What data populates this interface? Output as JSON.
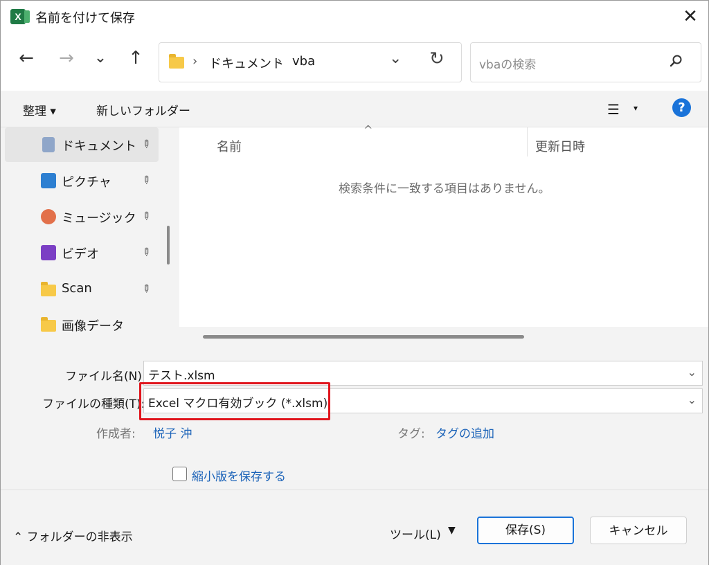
{
  "titlebar": {
    "title": "名前を付けて保存",
    "app_icon": "excel-icon",
    "app_icon_letter": "X",
    "close_glyph": "✕"
  },
  "nav": {
    "back_glyph": "←",
    "forward_glyph": "→",
    "recent_glyph": "⌄",
    "up_glyph": "↑",
    "breadcrumb": [
      "ドキュメント",
      "vba"
    ],
    "crumb_sep": "›",
    "address_dropdown_glyph": "⌄",
    "refresh_glyph": "↻",
    "search_placeholder": "vbaの検索"
  },
  "command_bar": {
    "organize_label": "整理 ▾",
    "new_folder_label": "新しいフォルダー",
    "view_glyph": "☰",
    "view_caret": "▾",
    "help_glyph": "?"
  },
  "sidebar": {
    "items": [
      {
        "label": "ドキュメント",
        "icon": "document-icon",
        "pinned": true,
        "active": true
      },
      {
        "label": "ピクチャ",
        "icon": "pictures-icon",
        "pinned": true
      },
      {
        "label": "ミュージック",
        "icon": "music-icon",
        "pinned": true
      },
      {
        "label": "ビデオ",
        "icon": "video-icon",
        "pinned": true
      },
      {
        "label": "Scan",
        "icon": "folder-icon",
        "pinned": true
      },
      {
        "label": "画像データ",
        "icon": "folder-icon",
        "pinned": false
      }
    ],
    "pin_glyph": "📌"
  },
  "file_list": {
    "columns": [
      "名前",
      "更新日時"
    ],
    "sort_glyph": "^",
    "empty_message": "検索条件に一致する項目はありません。"
  },
  "form": {
    "filename_label": "ファイル名(N):",
    "filename_value": "テスト.xlsm",
    "filetype_label": "ファイルの種類(T):",
    "filetype_value": "Excel マクロ有効ブック (*.xlsm)",
    "author_label": "作成者:",
    "author_value": "悦子 沖",
    "tag_label": "タグ:",
    "tag_value": "タグの追加",
    "thumbnail_label": "縮小版を保存する",
    "dropdown_glyph": "⌄",
    "highlight_color": "#e0151d"
  },
  "footer": {
    "hide_folders_label": "⌃ フォルダーの非表示",
    "tools_label": "ツール(L)",
    "tools_caret": "▼",
    "save_label": "保存(S)",
    "cancel_label": "キャンセル"
  },
  "colors": {
    "accent": "#1a73d9",
    "link": "#1a62b8",
    "excel_green": "#1f7a45",
    "folder": "#f7c948"
  }
}
